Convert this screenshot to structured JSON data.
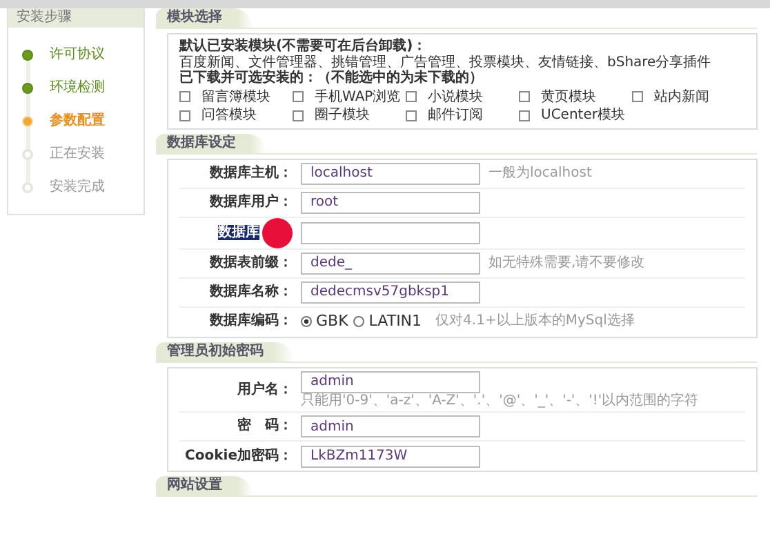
{
  "sidebar": {
    "title": "安装步骤",
    "steps": [
      {
        "label": "许可协议",
        "done": true,
        "current": false
      },
      {
        "label": "环境检测",
        "done": true,
        "current": false
      },
      {
        "label": "参数配置",
        "done": false,
        "current": true
      },
      {
        "label": "正在安装",
        "done": false,
        "current": false
      },
      {
        "label": "安装完成",
        "done": false,
        "current": false
      }
    ]
  },
  "modules": {
    "title": "模块选择",
    "installed_label": "默认已安装模块(不需要可在后台卸载)：",
    "installed_list": "百度新闻、文件管理器、挑错管理、广告管理、投票模块、友情链接、bShare分享插件",
    "available_label": "已下载并可选安装的：（不能选中的为未下载的）",
    "options": [
      {
        "label": "留言簿模块",
        "checked": false
      },
      {
        "label": "手机WAP浏览",
        "checked": false
      },
      {
        "label": "小说模块",
        "checked": false
      },
      {
        "label": "黄页模块",
        "checked": false
      },
      {
        "label": "站内新闻",
        "checked": false
      },
      {
        "label": "问答模块",
        "checked": false
      },
      {
        "label": "圈子模块",
        "checked": false
      },
      {
        "label": "邮件订阅",
        "checked": false
      },
      {
        "label": "UCenter模块",
        "checked": false
      }
    ]
  },
  "database": {
    "title": "数据库设定",
    "fields": [
      {
        "kind": "text",
        "label": "数据库主机：",
        "value": "localhost",
        "hint": "一般为localhost",
        "text_selected": false
      },
      {
        "kind": "text",
        "label": "数据库用户：",
        "value": "root",
        "text_selected": false
      },
      {
        "kind": "text",
        "label": "数据库",
        "text_selected": true
      },
      {
        "kind": "text",
        "label": "数据表前缀：",
        "value": "dede_",
        "hint": "如无特殊需要,请不要修改",
        "text_selected": false
      },
      {
        "kind": "text",
        "label": "数据库名称：",
        "value": "dedecmsv57gbksp1",
        "text_selected": false
      },
      {
        "kind": "radio",
        "label": "数据库编码：",
        "options": [
          {
            "label": "GBK",
            "selected": true
          },
          {
            "label": "LATIN1",
            "selected": false
          }
        ],
        "hint": "仅对4.1+以上版本的MySql选择",
        "text_selected": false
      }
    ]
  },
  "admin": {
    "title": "管理员初始密码",
    "fields": [
      {
        "kind": "text",
        "label": "用户名：",
        "value": "admin",
        "note": "只能用'0-9'、'a-z'、'A-Z'、'.'、'@'、'_'、'-'、'!'以内范围的字符"
      },
      {
        "kind": "text",
        "label": "密　码：",
        "value": "admin"
      },
      {
        "kind": "text",
        "label": "Cookie加密码：",
        "value": "LkBZm1173W"
      }
    ]
  },
  "site": {
    "title": "网站设置"
  }
}
